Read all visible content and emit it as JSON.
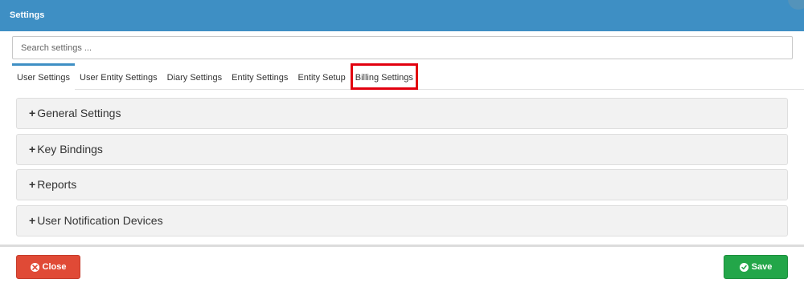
{
  "header": {
    "title": "Settings"
  },
  "search": {
    "placeholder": "Search settings ..."
  },
  "tabs": [
    {
      "label": "User Settings",
      "active": true
    },
    {
      "label": "User Entity Settings"
    },
    {
      "label": "Diary Settings"
    },
    {
      "label": "Entity Settings"
    },
    {
      "label": "Entity Setup"
    },
    {
      "label": "Billing Settings",
      "highlighted": true
    }
  ],
  "panels": [
    {
      "label": "General Settings"
    },
    {
      "label": "Key Bindings"
    },
    {
      "label": "Reports"
    },
    {
      "label": "User Notification Devices"
    }
  ],
  "panel_expand_symbol": "+",
  "footer": {
    "close_label": "Close",
    "save_label": "Save"
  },
  "colors": {
    "header": "#3e8fc4",
    "highlight_box": "#e2000f",
    "close_button": "#e04a36",
    "save_button": "#23a649"
  },
  "icons": {
    "close": "times-circle-icon",
    "save": "check-circle-icon"
  }
}
